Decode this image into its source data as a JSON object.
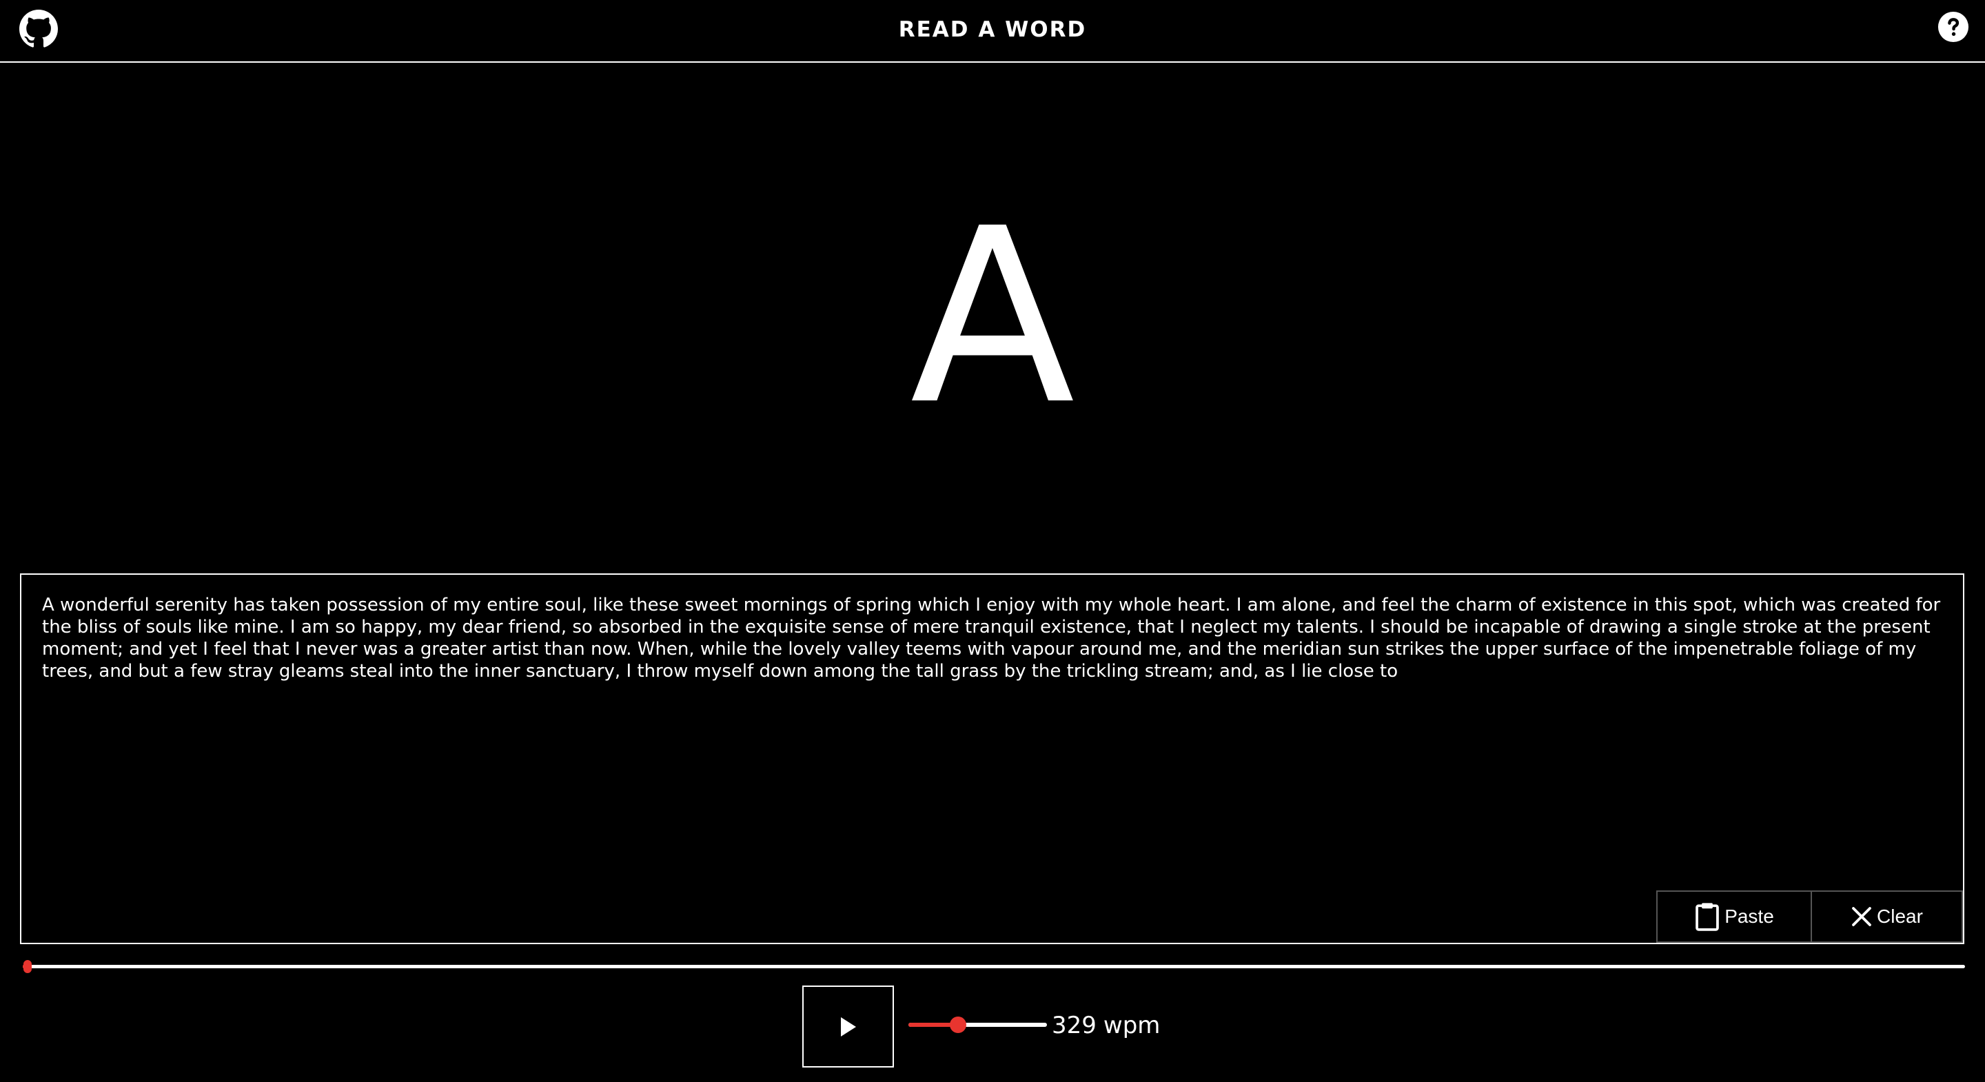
{
  "header": {
    "title": "READ A WORD",
    "github_icon": "github-icon",
    "help_icon": "help-circle-icon"
  },
  "reader": {
    "current_word": "A"
  },
  "text": {
    "content": "A wonderful serenity has taken possession of my entire soul, like these sweet mornings of spring which I enjoy with my whole heart. I am alone, and feel the charm of existence in this spot, which was created for the bliss of souls like mine. I am so happy, my dear friend, so absorbed in the exquisite sense of mere tranquil existence, that I neglect my talents. I should be incapable of drawing a single stroke at the present moment; and yet I feel that I never was a greater artist than now. When, while the lovely valley teems with vapour around me, and the meridian sun strikes the upper surface of the impenetrable foliage of my trees, and but a few stray gleams steal into the inner sanctuary, I throw myself down among the tall grass by the trickling stream; and, as I lie close to",
    "paste_label": "Paste",
    "paste_icon": "clipboard-icon",
    "clear_label": "Clear",
    "clear_icon": "close-icon"
  },
  "progress": {
    "value": 0.001
  },
  "controls": {
    "play_icon": "play-icon",
    "speed_value": "329",
    "speed_unit": "wpm",
    "speed_fraction": 0.36
  },
  "colors": {
    "background": "#000000",
    "foreground": "#ffffff",
    "accent": "#e8352f"
  }
}
